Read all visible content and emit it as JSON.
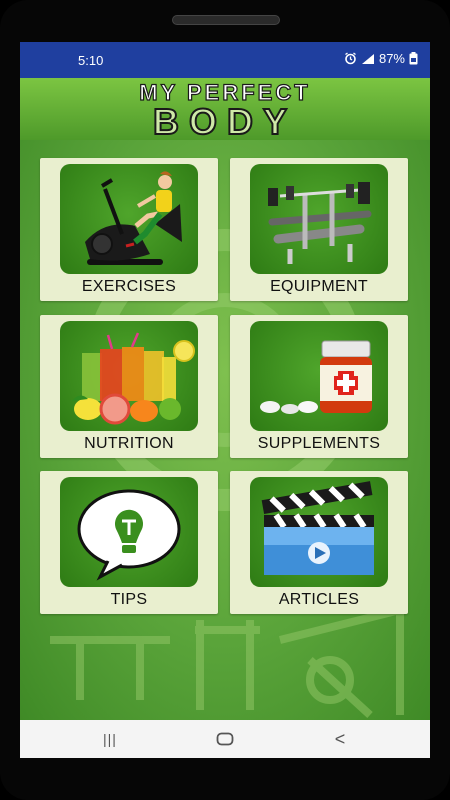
{
  "status": {
    "time": "5:10",
    "battery": "87%",
    "icons": [
      "alarm-icon",
      "signal-icon",
      "battery-icon"
    ]
  },
  "header": {
    "logo_top": "MY PERFECT",
    "logo_bottom": "BODY"
  },
  "menu": [
    {
      "label": "EXERCISES",
      "icon": "exercise-bike-icon"
    },
    {
      "label": "EQUIPMENT",
      "icon": "bench-press-icon"
    },
    {
      "label": "NUTRITION",
      "icon": "juice-fruit-icon"
    },
    {
      "label": "SUPPLEMENTS",
      "icon": "pill-bottle-icon"
    },
    {
      "label": "TIPS",
      "icon": "lightbulb-speech-icon"
    },
    {
      "label": "ARTICLES",
      "icon": "clapperboard-video-icon"
    }
  ],
  "navbar": {
    "recents": "|||",
    "home": "○",
    "back": "<"
  },
  "colors": {
    "status_bar": "#1f3f9f",
    "header_green": "#6cb83a",
    "tile_bg": "#e9efcf",
    "tile_img": "#3a8f1e"
  }
}
